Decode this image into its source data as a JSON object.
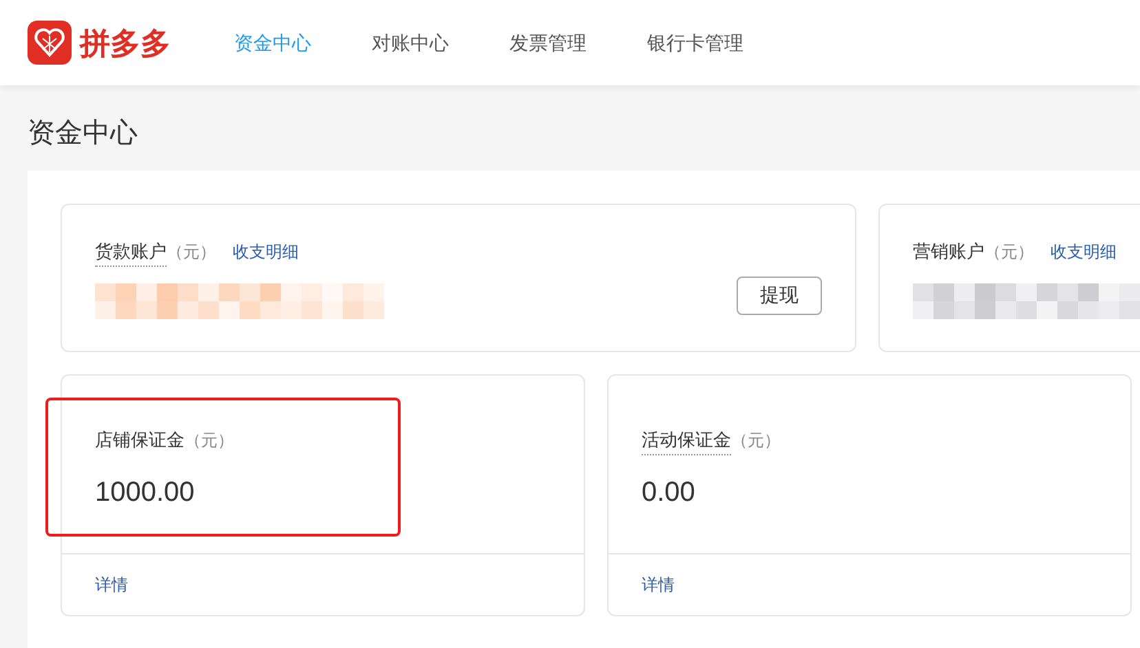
{
  "brand": {
    "name": "拼多多"
  },
  "nav": [
    {
      "label": "资金中心",
      "selected": true
    },
    {
      "label": "对账中心",
      "selected": false
    },
    {
      "label": "发票管理",
      "selected": false
    },
    {
      "label": "银行卡管理",
      "selected": false
    }
  ],
  "page_title": "资金中心",
  "accounts": [
    {
      "name": "货款账户",
      "unit": "（元）",
      "link": "收支明细",
      "underlined": true,
      "amount_hidden": true,
      "color": "#fdc7a3",
      "button": "提现"
    },
    {
      "name": "营销账户",
      "unit": "（元）",
      "link": "收支明细",
      "underlined": false,
      "amount_hidden": true,
      "color": "#c4c4ca"
    }
  ],
  "deposits": [
    {
      "name": "店铺保证金",
      "unit": "（元）",
      "underlined": false,
      "amount": "1000.00",
      "link": "详情",
      "highlighted": true
    },
    {
      "name": "活动保证金",
      "unit": "（元）",
      "underlined": true,
      "amount": "0.00",
      "link": "详情",
      "highlighted": false
    }
  ]
}
